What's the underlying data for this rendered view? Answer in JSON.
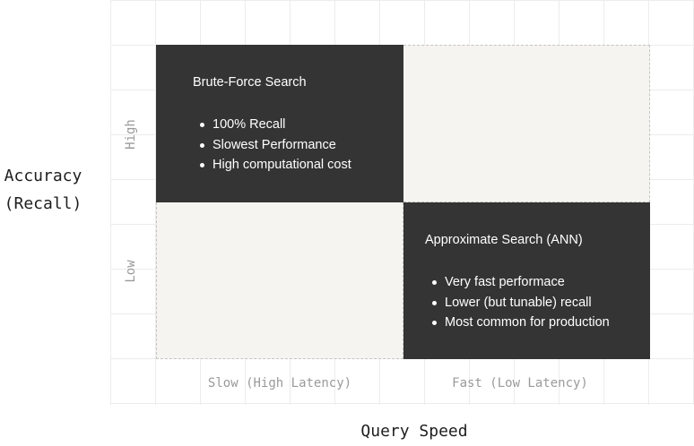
{
  "axes": {
    "y_title_line1": "Accuracy",
    "y_title_line2": "(Recall)",
    "y_high": "High",
    "y_low": "Low",
    "x_slow": "Slow (High Latency)",
    "x_fast": "Fast (Low Latency)",
    "x_title": "Query Speed"
  },
  "quadrants": {
    "top_left": {
      "title": "Brute-Force Search",
      "bullets": [
        "100% Recall",
        "Slowest Performance",
        "High computational cost"
      ]
    },
    "bottom_right": {
      "title": "Approximate Search (ANN)",
      "bullets": [
        "Very fast performace",
        "Lower (but tunable) recall",
        "Most common for production"
      ]
    }
  },
  "colors": {
    "dark_quadrant": "#343434",
    "light_quadrant": "#f5f4f1"
  }
}
